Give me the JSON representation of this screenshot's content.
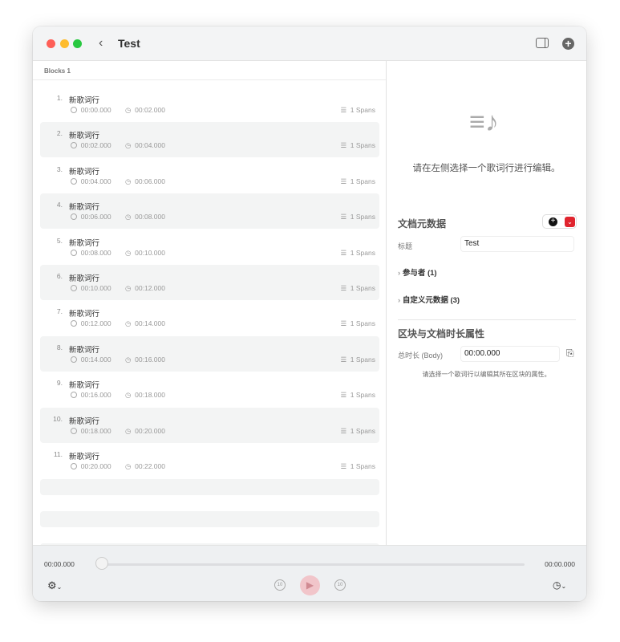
{
  "window": {
    "title": "Test",
    "colors": {
      "close": "#fe5f57",
      "minimize": "#febc2e",
      "zoom": "#28c840"
    }
  },
  "left": {
    "header": "Blocks 1",
    "rows": [
      {
        "n": "1.",
        "name": "新歌词行",
        "start": "00:00.000",
        "end": "00:02.000",
        "spans": "1 Spans"
      },
      {
        "n": "2.",
        "name": "新歌词行",
        "start": "00:02.000",
        "end": "00:04.000",
        "spans": "1 Spans"
      },
      {
        "n": "3.",
        "name": "新歌词行",
        "start": "00:04.000",
        "end": "00:06.000",
        "spans": "1 Spans"
      },
      {
        "n": "4.",
        "name": "新歌词行",
        "start": "00:06.000",
        "end": "00:08.000",
        "spans": "1 Spans"
      },
      {
        "n": "5.",
        "name": "新歌词行",
        "start": "00:08.000",
        "end": "00:10.000",
        "spans": "1 Spans"
      },
      {
        "n": "6.",
        "name": "新歌词行",
        "start": "00:10.000",
        "end": "00:12.000",
        "spans": "1 Spans"
      },
      {
        "n": "7.",
        "name": "新歌词行",
        "start": "00:12.000",
        "end": "00:14.000",
        "spans": "1 Spans"
      },
      {
        "n": "8.",
        "name": "新歌词行",
        "start": "00:14.000",
        "end": "00:16.000",
        "spans": "1 Spans"
      },
      {
        "n": "9.",
        "name": "新歌词行",
        "start": "00:16.000",
        "end": "00:18.000",
        "spans": "1 Spans"
      },
      {
        "n": "10.",
        "name": "新歌词行",
        "start": "00:18.000",
        "end": "00:20.000",
        "spans": "1 Spans"
      },
      {
        "n": "11.",
        "name": "新歌词行",
        "start": "00:20.000",
        "end": "00:22.000",
        "spans": "1 Spans"
      }
    ]
  },
  "right": {
    "empty_hint": "请在左侧选择一个歌词行进行编辑。",
    "metadata": {
      "heading": "文档元数据",
      "title_label": "标题",
      "title_value": "Test",
      "participants": "参与者 (1)",
      "custom": "自定义元数据 (3)"
    },
    "duration": {
      "heading": "区块与文档时长属性",
      "label": "总时长 (Body)",
      "value": "00:00.000",
      "note": "请选择一个歌词行以编辑其所在区块的属性。"
    }
  },
  "player": {
    "current": "00:00.000",
    "total": "00:00.000",
    "progress": 0,
    "skip_back": "10",
    "skip_fwd": "10"
  }
}
